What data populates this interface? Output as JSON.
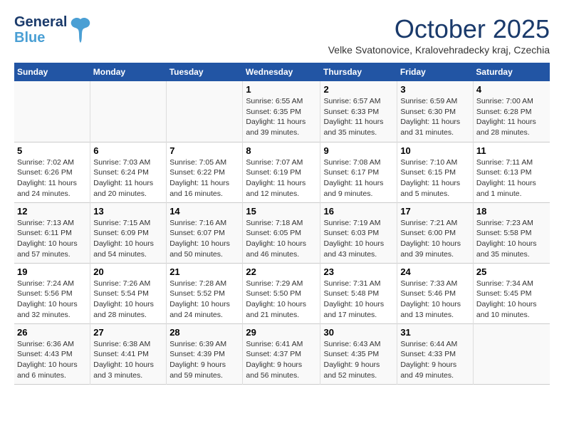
{
  "header": {
    "logo_line1": "General",
    "logo_line2": "Blue",
    "month": "October 2025",
    "location": "Velke Svatonovice, Kralovehradecky kraj, Czechia"
  },
  "weekdays": [
    "Sunday",
    "Monday",
    "Tuesday",
    "Wednesday",
    "Thursday",
    "Friday",
    "Saturday"
  ],
  "weeks": [
    [
      {
        "day": "",
        "info": ""
      },
      {
        "day": "",
        "info": ""
      },
      {
        "day": "",
        "info": ""
      },
      {
        "day": "1",
        "info": "Sunrise: 6:55 AM\nSunset: 6:35 PM\nDaylight: 11 hours\nand 39 minutes."
      },
      {
        "day": "2",
        "info": "Sunrise: 6:57 AM\nSunset: 6:33 PM\nDaylight: 11 hours\nand 35 minutes."
      },
      {
        "day": "3",
        "info": "Sunrise: 6:59 AM\nSunset: 6:30 PM\nDaylight: 11 hours\nand 31 minutes."
      },
      {
        "day": "4",
        "info": "Sunrise: 7:00 AM\nSunset: 6:28 PM\nDaylight: 11 hours\nand 28 minutes."
      }
    ],
    [
      {
        "day": "5",
        "info": "Sunrise: 7:02 AM\nSunset: 6:26 PM\nDaylight: 11 hours\nand 24 minutes."
      },
      {
        "day": "6",
        "info": "Sunrise: 7:03 AM\nSunset: 6:24 PM\nDaylight: 11 hours\nand 20 minutes."
      },
      {
        "day": "7",
        "info": "Sunrise: 7:05 AM\nSunset: 6:22 PM\nDaylight: 11 hours\nand 16 minutes."
      },
      {
        "day": "8",
        "info": "Sunrise: 7:07 AM\nSunset: 6:19 PM\nDaylight: 11 hours\nand 12 minutes."
      },
      {
        "day": "9",
        "info": "Sunrise: 7:08 AM\nSunset: 6:17 PM\nDaylight: 11 hours\nand 9 minutes."
      },
      {
        "day": "10",
        "info": "Sunrise: 7:10 AM\nSunset: 6:15 PM\nDaylight: 11 hours\nand 5 minutes."
      },
      {
        "day": "11",
        "info": "Sunrise: 7:11 AM\nSunset: 6:13 PM\nDaylight: 11 hours\nand 1 minute."
      }
    ],
    [
      {
        "day": "12",
        "info": "Sunrise: 7:13 AM\nSunset: 6:11 PM\nDaylight: 10 hours\nand 57 minutes."
      },
      {
        "day": "13",
        "info": "Sunrise: 7:15 AM\nSunset: 6:09 PM\nDaylight: 10 hours\nand 54 minutes."
      },
      {
        "day": "14",
        "info": "Sunrise: 7:16 AM\nSunset: 6:07 PM\nDaylight: 10 hours\nand 50 minutes."
      },
      {
        "day": "15",
        "info": "Sunrise: 7:18 AM\nSunset: 6:05 PM\nDaylight: 10 hours\nand 46 minutes."
      },
      {
        "day": "16",
        "info": "Sunrise: 7:19 AM\nSunset: 6:03 PM\nDaylight: 10 hours\nand 43 minutes."
      },
      {
        "day": "17",
        "info": "Sunrise: 7:21 AM\nSunset: 6:00 PM\nDaylight: 10 hours\nand 39 minutes."
      },
      {
        "day": "18",
        "info": "Sunrise: 7:23 AM\nSunset: 5:58 PM\nDaylight: 10 hours\nand 35 minutes."
      }
    ],
    [
      {
        "day": "19",
        "info": "Sunrise: 7:24 AM\nSunset: 5:56 PM\nDaylight: 10 hours\nand 32 minutes."
      },
      {
        "day": "20",
        "info": "Sunrise: 7:26 AM\nSunset: 5:54 PM\nDaylight: 10 hours\nand 28 minutes."
      },
      {
        "day": "21",
        "info": "Sunrise: 7:28 AM\nSunset: 5:52 PM\nDaylight: 10 hours\nand 24 minutes."
      },
      {
        "day": "22",
        "info": "Sunrise: 7:29 AM\nSunset: 5:50 PM\nDaylight: 10 hours\nand 21 minutes."
      },
      {
        "day": "23",
        "info": "Sunrise: 7:31 AM\nSunset: 5:48 PM\nDaylight: 10 hours\nand 17 minutes."
      },
      {
        "day": "24",
        "info": "Sunrise: 7:33 AM\nSunset: 5:46 PM\nDaylight: 10 hours\nand 13 minutes."
      },
      {
        "day": "25",
        "info": "Sunrise: 7:34 AM\nSunset: 5:45 PM\nDaylight: 10 hours\nand 10 minutes."
      }
    ],
    [
      {
        "day": "26",
        "info": "Sunrise: 6:36 AM\nSunset: 4:43 PM\nDaylight: 10 hours\nand 6 minutes."
      },
      {
        "day": "27",
        "info": "Sunrise: 6:38 AM\nSunset: 4:41 PM\nDaylight: 10 hours\nand 3 minutes."
      },
      {
        "day": "28",
        "info": "Sunrise: 6:39 AM\nSunset: 4:39 PM\nDaylight: 9 hours\nand 59 minutes."
      },
      {
        "day": "29",
        "info": "Sunrise: 6:41 AM\nSunset: 4:37 PM\nDaylight: 9 hours\nand 56 minutes."
      },
      {
        "day": "30",
        "info": "Sunrise: 6:43 AM\nSunset: 4:35 PM\nDaylight: 9 hours\nand 52 minutes."
      },
      {
        "day": "31",
        "info": "Sunrise: 6:44 AM\nSunset: 4:33 PM\nDaylight: 9 hours\nand 49 minutes."
      },
      {
        "day": "",
        "info": ""
      }
    ]
  ]
}
